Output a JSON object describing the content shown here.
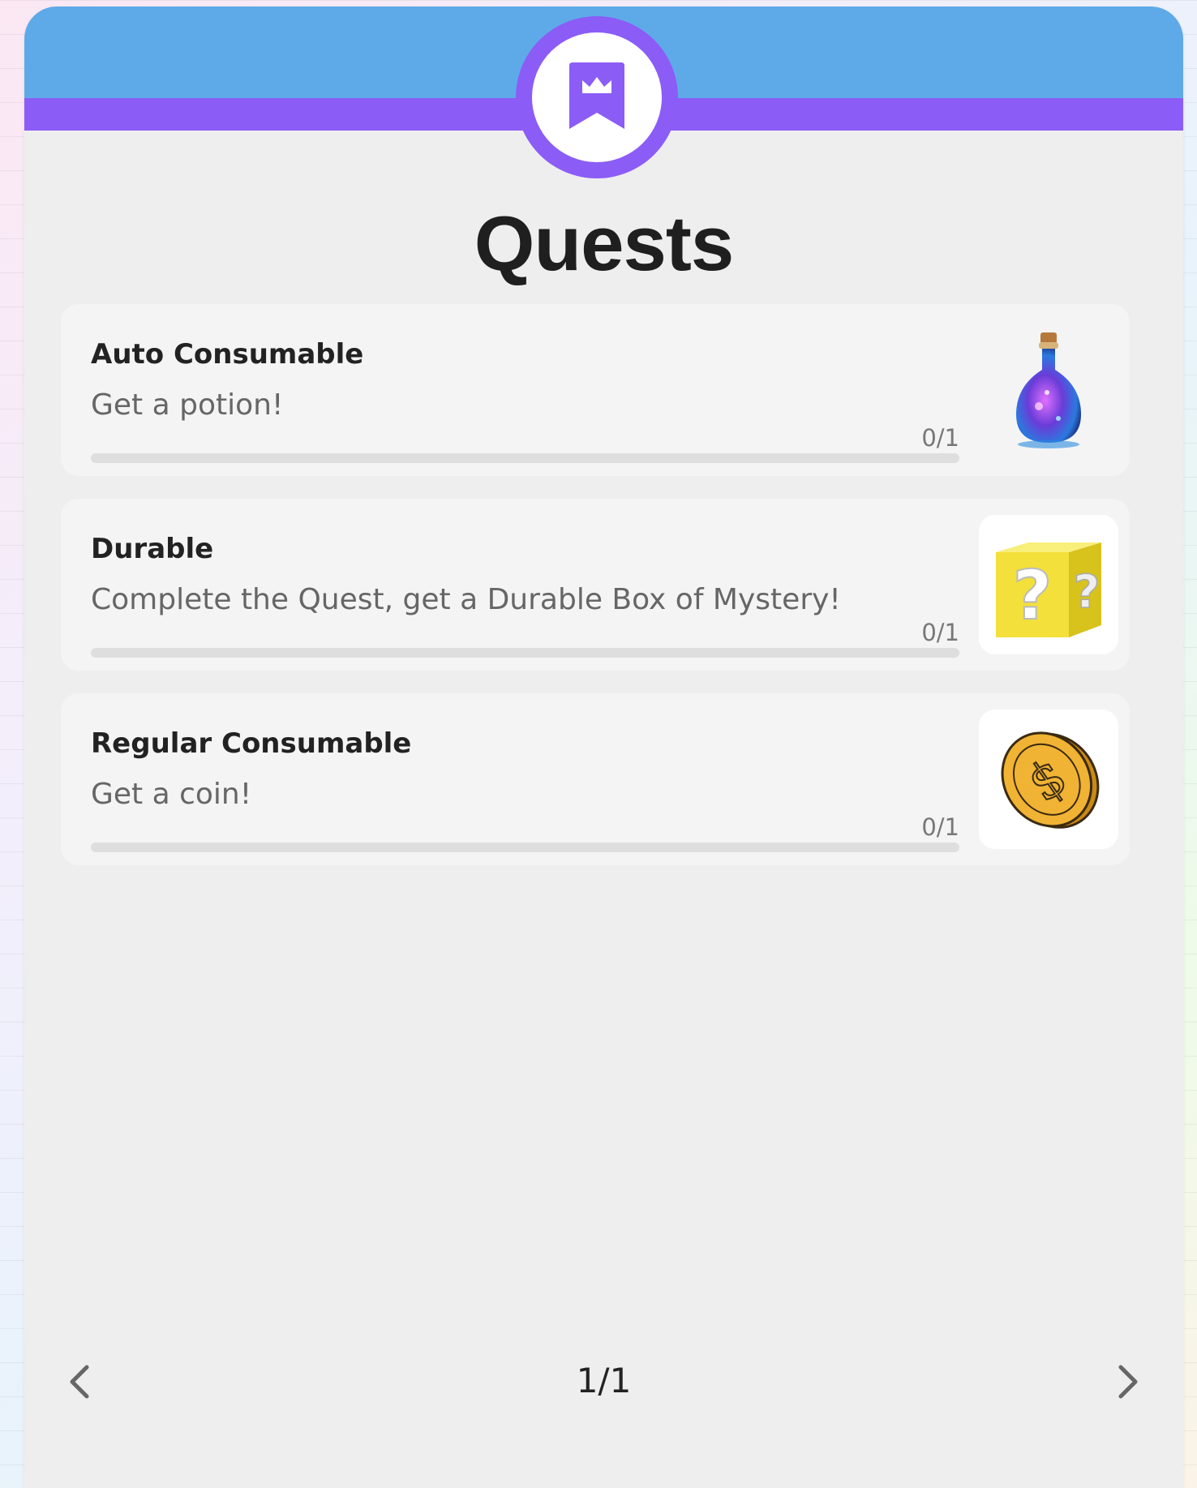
{
  "header": {
    "title": "Quests",
    "badge_icon": "crown-bookmark-icon",
    "colors": {
      "top": "#5eaae8",
      "accent": "#8b5cf6"
    }
  },
  "quests": [
    {
      "title": "Auto Consumable",
      "description": "Get a potion!",
      "progress_label": "0/1",
      "progress": 0,
      "reward_icon": "potion-icon"
    },
    {
      "title": "Durable",
      "description": "Complete the Quest, get a Durable Box of Mystery!",
      "progress_label": "0/1",
      "progress": 0,
      "reward_icon": "mystery-box-icon"
    },
    {
      "title": "Regular Consumable",
      "description": "Get a coin!",
      "progress_label": "0/1",
      "progress": 0,
      "reward_icon": "coin-icon"
    }
  ],
  "pagination": {
    "label": "1/1",
    "prev_icon": "chevron-left-icon",
    "next_icon": "chevron-right-icon"
  }
}
